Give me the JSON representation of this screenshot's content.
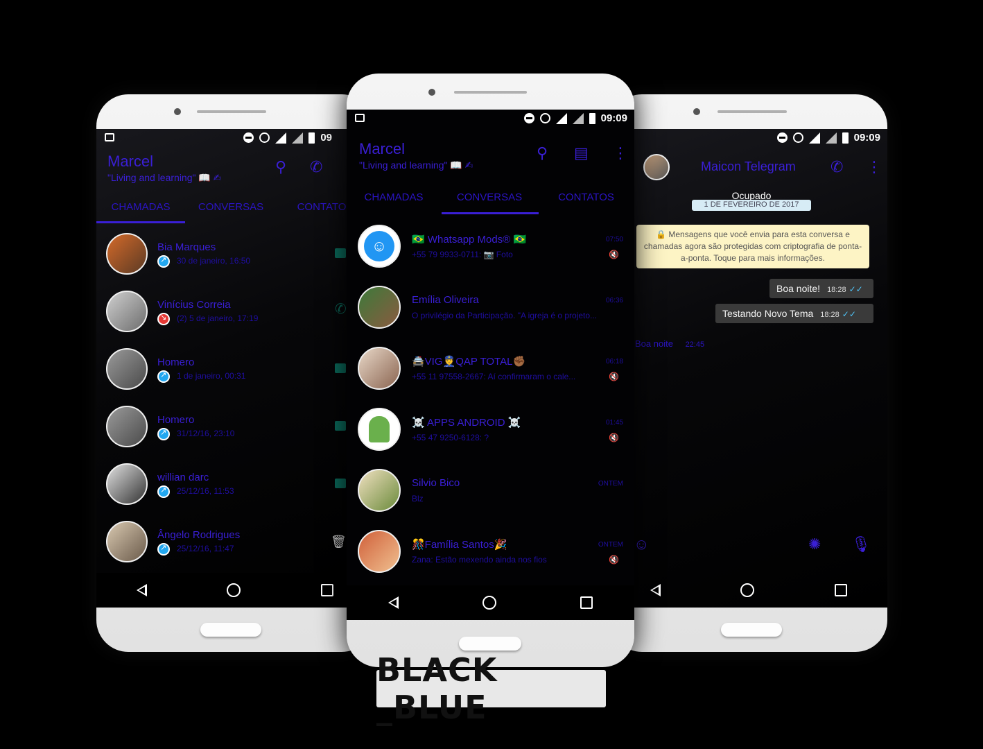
{
  "brand_label": "BLACK _BLUE",
  "colors": {
    "accent": "#3a1fd6",
    "background": "#000000",
    "bubble": "#3a3a3a",
    "system_notice": "#fdf4c5"
  },
  "left_phone": {
    "status_time": "09",
    "profile_name": "Marcel",
    "profile_status": "\"Living and learning\" 📖 ✍",
    "tabs": [
      "CHAMADAS",
      "CONVERSAS",
      "CONTATOS"
    ],
    "calls": [
      {
        "name": "Bia Marques",
        "detail": "30 de janeiro, 16:50",
        "type": "outgoing"
      },
      {
        "name": "Vinícius Correia",
        "detail": "(2)  5 de janeiro, 17:19",
        "type": "missed"
      },
      {
        "name": "Homero",
        "detail": "1 de janeiro, 00:31",
        "type": "outgoing"
      },
      {
        "name": "Homero",
        "detail": "31/12/16, 23:10",
        "type": "outgoing"
      },
      {
        "name": "willian darc",
        "detail": "25/12/16, 11:53",
        "type": "outgoing"
      },
      {
        "name": "Ângelo Rodrigues",
        "detail": "25/12/16, 11:47",
        "type": "outgoing"
      }
    ]
  },
  "center_phone": {
    "status_time": "09:09",
    "profile_name": "Marcel",
    "profile_status": "\"Living and learning\" 📖 ✍",
    "tabs": [
      "CHAMADAS",
      "CONVERSAS",
      "CONTATOS"
    ],
    "chats": [
      {
        "name": "🇧🇷 Whatsapp Mods® 🇧🇷",
        "preview": "+55 79 9933-0711: 📷 Foto",
        "time": "07:50"
      },
      {
        "name": "Emília Oliveira",
        "preview": "O privilégio da Participação. \"A igreja é o projeto...",
        "time": "06:36"
      },
      {
        "name": "🚔VIG👮QAP TOTAL✊🏾",
        "preview": "+55 11 97558-2667: Aí confirmaram o cale...",
        "time": "06:18"
      },
      {
        "name": "☠️ APPS ANDROID ☠️",
        "preview": "+55 47 9250-6128: ?",
        "time": "01:45"
      },
      {
        "name": "Silvio Bico",
        "preview": "Blz",
        "time": "ONTEM"
      },
      {
        "name": "🎊Família Santos🎉",
        "preview": "Zana: Estão mexendo ainda nos fios",
        "time": "ONTEM"
      }
    ]
  },
  "right_phone": {
    "status_time": "09:09",
    "contact_name": "Maicon Telegram",
    "contact_status": "Ocupado",
    "date_chip": "1 DE FEVEREIRO DE 2017",
    "encryption_notice": "🔒 Mensagens que você envia para esta conversa e chamadas agora são protegidas com criptografia de ponta-a-ponta. Toque para mais informações.",
    "messages": [
      {
        "text": "Boa noite!",
        "time": "18:28",
        "ticks": "✓✓"
      },
      {
        "text": "Testando Novo Tema",
        "time": "18:28",
        "ticks": "✓✓"
      }
    ],
    "incoming": {
      "text": "Boa noite",
      "time": "22:45"
    }
  }
}
